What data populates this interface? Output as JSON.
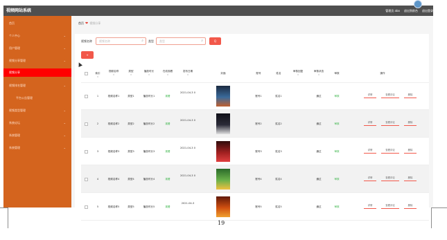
{
  "app": {
    "title": "视频网站系统"
  },
  "topbar": {
    "user": "管理员 abo",
    "back": "退出到前台",
    "logout": "退出登录"
  },
  "sidebar": {
    "items": [
      {
        "label": "首页",
        "arrow": ""
      },
      {
        "label": "个人中心",
        "arrow": "⌄"
      },
      {
        "label": "用户管理",
        "arrow": "⌄"
      },
      {
        "label": "视频分享管理",
        "arrow": "⌄"
      },
      {
        "label": "视频分享",
        "arrow": ""
      },
      {
        "label": "视频排名管理",
        "arrow": "⌄"
      },
      {
        "label": "平台公告管理",
        "arrow": ""
      },
      {
        "label": "视频类型管理",
        "arrow": "⌄"
      },
      {
        "label": "系统论坛",
        "arrow": "⌄"
      },
      {
        "label": "系统管理",
        "arrow": "⌄"
      },
      {
        "label": "系统管理",
        "arrow": "⌄"
      }
    ]
  },
  "breadcrumb": {
    "home": "首页",
    "heart": "❤",
    "current": "视频分享"
  },
  "filters": {
    "name_label": "视频名称",
    "name_placeholder": "视频名称",
    "type_label": "类型",
    "type_placeholder": "类型",
    "search_label": "Q",
    "add_label": "+"
  },
  "table": {
    "headers": [
      "",
      "索引",
      "视频名称",
      "类型",
      "播放时长",
      "在线观看",
      "发布日期",
      "封面",
      "账号",
      "姓名",
      "审核回复",
      "审核状态",
      "审核",
      "操作"
    ],
    "sort_mark": "⇕",
    "rows": [
      {
        "index": "1",
        "name": "视频名称1",
        "type": "类型1",
        "duration": "播放时长1",
        "watch": "观看",
        "date": "2021-04-3 0",
        "account": "账号1",
        "person": "姓名1",
        "reply": "",
        "status": "通过",
        "audit": "审核"
      },
      {
        "index": "2",
        "name": "视频名称2",
        "type": "类型2",
        "duration": "播放时长2",
        "watch": "观看",
        "date": "2021-04-3 0",
        "account": "账号2",
        "person": "姓名2",
        "reply": "",
        "status": "通过",
        "audit": "审核"
      },
      {
        "index": "3",
        "name": "视频名称3",
        "type": "类型3",
        "duration": "播放时长3",
        "watch": "观看",
        "date": "2021-04-3 0",
        "account": "账号3",
        "person": "姓名3",
        "reply": "",
        "status": "通过",
        "audit": "审核"
      },
      {
        "index": "4",
        "name": "视频名称4",
        "type": "类型4",
        "duration": "播放时长4",
        "watch": "观看",
        "date": "2021-04-3 0",
        "account": "账号4",
        "person": "姓名4",
        "reply": "",
        "status": "通过",
        "audit": "审核"
      },
      {
        "index": "5",
        "name": "视频名称5",
        "type": "类型5",
        "duration": "播放时长5",
        "watch": "观看",
        "date": "2021-04-3",
        "account": "账号5",
        "person": "姓名5",
        "reply": "",
        "status": "通过",
        "audit": "审核"
      }
    ],
    "ops": {
      "detail": "详情",
      "review": "查看评论",
      "delete": "删除"
    }
  },
  "footer": {
    "page_number": "19"
  },
  "colors": {
    "sidebar": "#d4641e",
    "active": "#ff0000",
    "accent": "#f2584a",
    "topbar": "#4f4f4f",
    "link": "#3bb54a"
  },
  "icons": {
    "search": "search-icon",
    "heart": "heart-icon",
    "edit": "edit-icon",
    "delete": "trash-icon"
  }
}
